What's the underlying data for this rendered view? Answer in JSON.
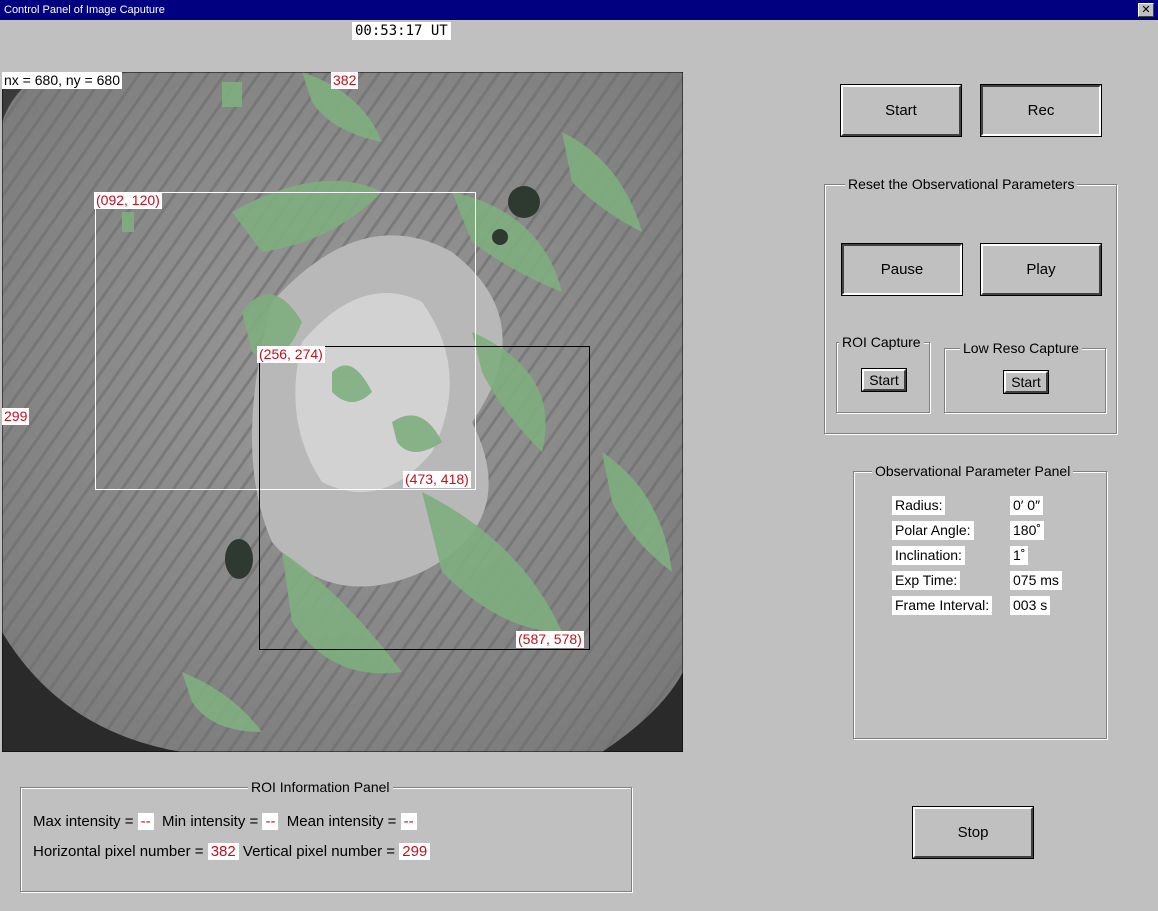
{
  "window": {
    "title": "Control Panel of Image Caputure",
    "close_glyph": "✕"
  },
  "clock": "00:53:17 UT",
  "image": {
    "size_label": "nx = 680, ny = 680",
    "cursor_x": "382",
    "cursor_y": "299",
    "roi_white": {
      "top_left": "(092, 120)",
      "bottom_right": "(473, 418)"
    },
    "roi_black": {
      "top_left": "(256, 274)",
      "bottom_right": "(587, 578)"
    }
  },
  "buttons": {
    "start": "Start",
    "rec": "Rec",
    "pause": "Pause",
    "play": "Play",
    "stop": "Stop"
  },
  "reset_panel": {
    "title": "Reset the Observational Parameters",
    "roi_capture": {
      "title": "ROI Capture",
      "button": "Start"
    },
    "low_reso_capture": {
      "title": "Low Reso Capture",
      "button": "Start"
    }
  },
  "param_panel": {
    "title": "Observational Parameter Panel",
    "rows": [
      {
        "label": "Radius:",
        "value": "0′ 0″"
      },
      {
        "label": "Polar Angle:",
        "value": "180˚"
      },
      {
        "label": "Inclination:",
        "value": "1˚"
      },
      {
        "label": "Exp Time:",
        "value": "075",
        "unit": "ms"
      },
      {
        "label": "Frame Interval:",
        "value": "003",
        "unit": "s"
      }
    ]
  },
  "roi_info": {
    "title": "ROI Information Panel",
    "max_label": "Max intensity =",
    "max_value": "--",
    "min_label": "Min intensity =",
    "min_value": "--",
    "mean_label": "Mean intensity =",
    "mean_value": "--",
    "hpix_label": "Horizontal pixel number =",
    "hpix_value": "382",
    "vpix_label": "Vertical pixel number =",
    "vpix_value": "299"
  },
  "colors": {
    "titlebar": "#000080",
    "label_red": "#c0101c",
    "overlay_green": "#7fae7f"
  }
}
